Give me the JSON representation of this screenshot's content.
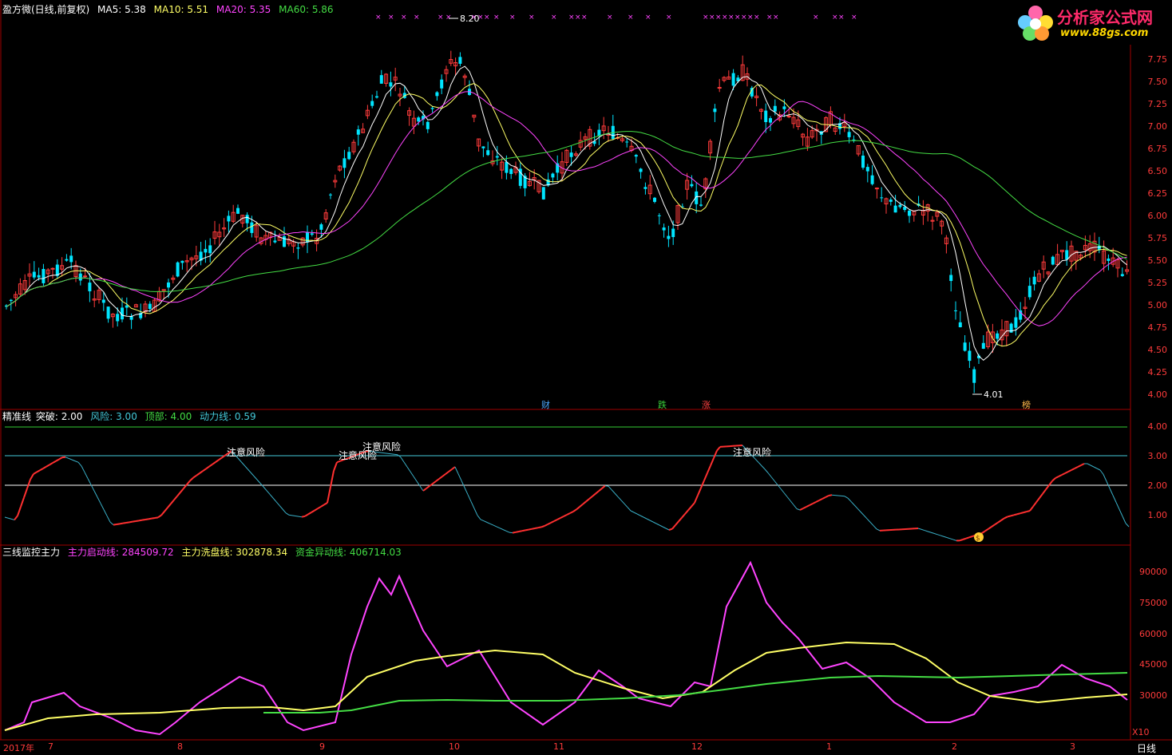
{
  "header1": {
    "title": "盈方微(日线,前复权)",
    "ma5": "MA5: 5.38",
    "ma10": "MA10: 5.51",
    "ma20": "MA20: 5.35",
    "ma60": "MA60: 5.86"
  },
  "header2": {
    "title": "精准线",
    "breakthrough": "突破: 2.00",
    "risk": "风险: 3.00",
    "top": "顶部: 4.00",
    "power": "动力线: 0.59"
  },
  "header3": {
    "title": "三线监控主力",
    "launch": "主力启动线: 284509.72",
    "wash": "主力洗盘线: 302878.34",
    "abnormal": "资金异动线: 406714.03"
  },
  "logo": {
    "name": "分析家公式网",
    "url": "www.88gs.com"
  },
  "price_axis": [
    "7.75",
    "7.50",
    "7.25",
    "7.00",
    "6.75",
    "6.50",
    "6.25",
    "6.00",
    "5.75",
    "5.50",
    "5.25",
    "5.00",
    "4.75",
    "4.50",
    "4.25",
    "4.00"
  ],
  "indicator_axis": [
    "4.00",
    "3.00",
    "2.00",
    "1.00"
  ],
  "volume_axis": [
    "90000",
    "75000",
    "60000",
    "45000",
    "30000"
  ],
  "x10_label": "X10",
  "dates": [
    "2017年",
    "7",
    "8",
    "9",
    "10",
    "11",
    "12",
    "1",
    "2",
    "3"
  ],
  "markers": {
    "high": "8.20",
    "low": "4.01"
  },
  "tags": [
    {
      "text": "财",
      "color": "#4aa8ff"
    },
    {
      "text": "跌",
      "color": "#3bd13b"
    },
    {
      "text": "涨",
      "color": "#ff4040"
    },
    {
      "text": "榜",
      "color": "#ffb84a"
    }
  ],
  "risk_labels": [
    "注意风险",
    "注意风险",
    "注意风险",
    "注意风险"
  ],
  "period": "日线",
  "colors": {
    "up": "#ff3b3b",
    "down": "#00e5ff",
    "ma5": "#ffffff",
    "ma10": "#ffff66",
    "ma20": "#ff44ff",
    "ma60": "#44dd44",
    "grid": "#7a0000"
  }
}
